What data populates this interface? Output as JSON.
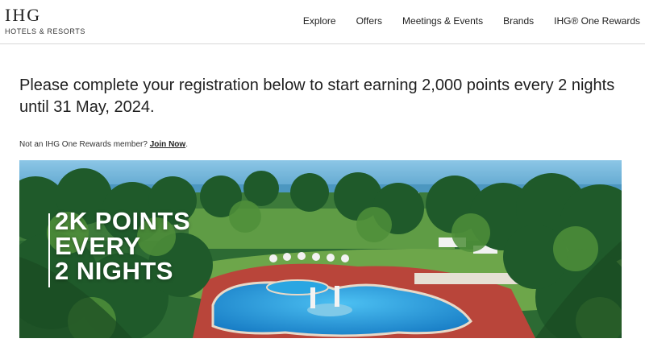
{
  "brand": {
    "logo_text": "IHG",
    "logo_subtext": "HOTELS & RESORTS"
  },
  "nav": {
    "items": [
      "Explore",
      "Offers",
      "Meetings & Events",
      "Brands",
      "IHG® One Rewards"
    ]
  },
  "main": {
    "headline": "Please complete your registration below to start earning 2,000 points every 2 nights until 31 May, 2024.",
    "join_prompt": "Not an IHG One Rewards member?",
    "join_link": "Join Now",
    "join_suffix": "."
  },
  "banner": {
    "promo_lines": [
      "2K POINTS",
      "EVERY",
      "2 NIGHTS"
    ],
    "image_subject": "resort pool surrounded by palm trees",
    "colors": {
      "sky": "#7fb8d8",
      "sea": "#4f9cc4",
      "palm_dark": "#1f5a2a",
      "palm_light": "#4f8f3a",
      "pool": "#1e9ad8",
      "pool_deck": "#c0443a",
      "lawn": "#6fa544"
    }
  }
}
